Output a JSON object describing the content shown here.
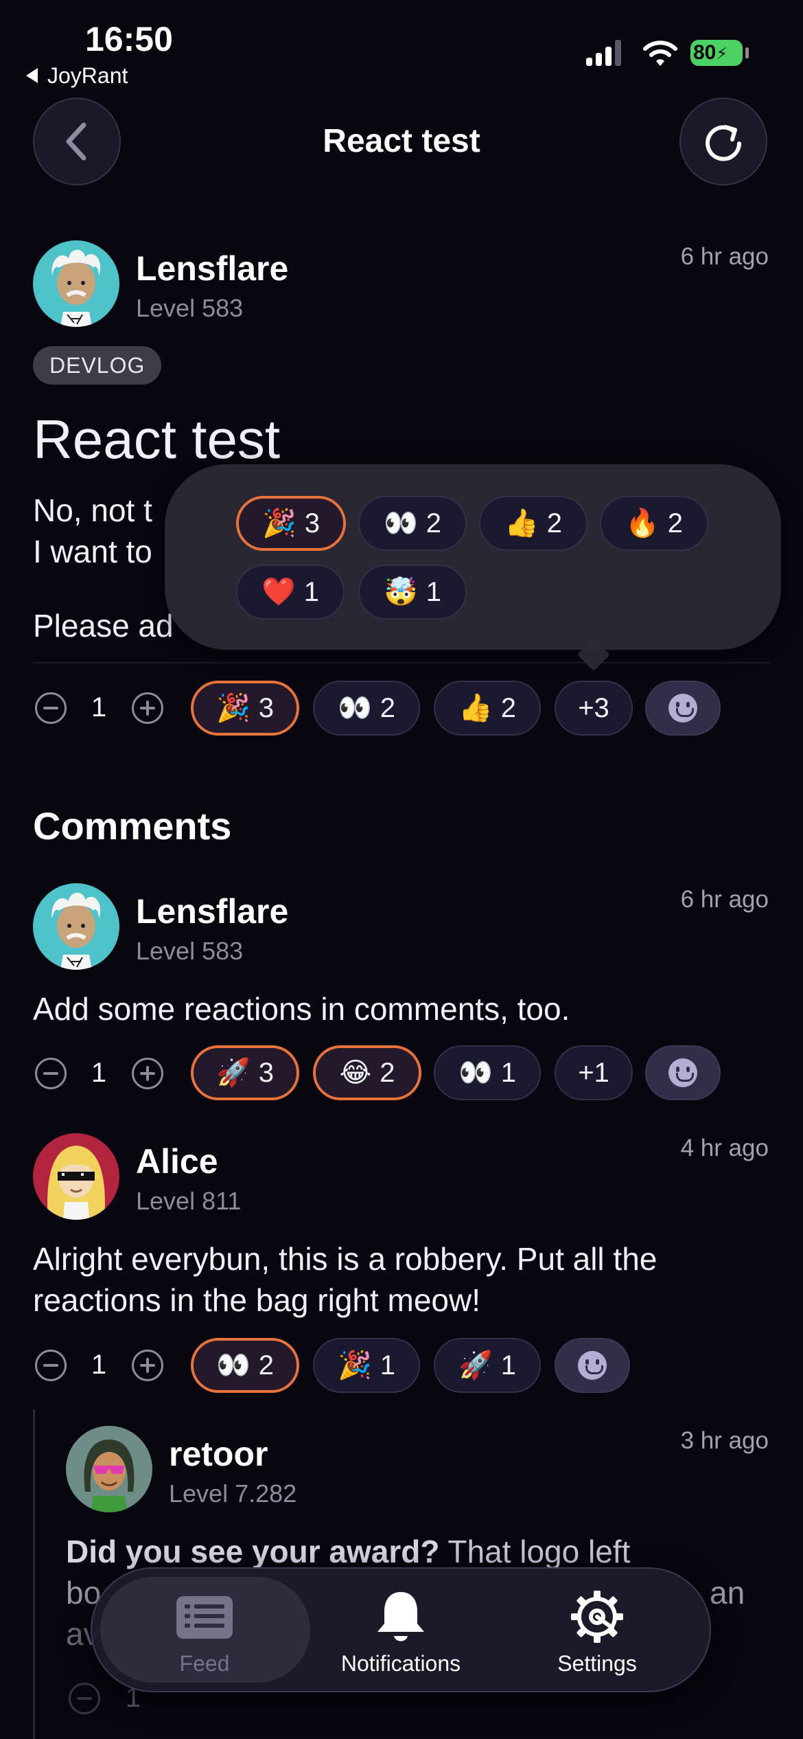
{
  "status_bar": {
    "time": "16:50",
    "back_app": "JoyRant",
    "battery": "80"
  },
  "header": {
    "title": "React test"
  },
  "post": {
    "author": "Lensflare",
    "level": "Level 583",
    "time": "6 hr ago",
    "tag": "DEVLOG",
    "title": "React test",
    "line1": "No, not t",
    "line2": "I want to",
    "line3": "Please ad",
    "score": "1",
    "reactions": [
      {
        "emoji": "🎉",
        "count": "3",
        "mine": true
      },
      {
        "emoji": "👀",
        "count": "2",
        "mine": false
      },
      {
        "emoji": "👍",
        "count": "2",
        "mine": false
      }
    ],
    "more": "+3"
  },
  "popover": {
    "reactions": [
      {
        "emoji": "🎉",
        "count": "3",
        "mine": true
      },
      {
        "emoji": "👀",
        "count": "2",
        "mine": false
      },
      {
        "emoji": "👍",
        "count": "2",
        "mine": false
      },
      {
        "emoji": "🔥",
        "count": "2",
        "mine": false
      },
      {
        "emoji": "❤️",
        "count": "1",
        "mine": false
      },
      {
        "emoji": "🤯",
        "count": "1",
        "mine": false
      }
    ]
  },
  "comments_title": "Comments",
  "comments": [
    {
      "author": "Lensflare",
      "level": "Level 583",
      "time": "6 hr ago",
      "text": "Add some reactions in comments, too.",
      "score": "1",
      "reactions": [
        {
          "emoji": "🚀",
          "count": "3"
        },
        {
          "emoji": "😂",
          "count": "2"
        },
        {
          "emoji": "👀",
          "count": "1"
        }
      ],
      "more": "+1"
    },
    {
      "author": "Alice",
      "level": "Level 811",
      "time": "4 hr ago",
      "line1": "Alright everybun, this is a robbery. Put all the",
      "line2": "reactions in the bag right meow!",
      "score": "1",
      "reactions": [
        {
          "emoji": "👀",
          "count": "2"
        },
        {
          "emoji": "🎉",
          "count": "1"
        },
        {
          "emoji": "🚀",
          "count": "1"
        }
      ]
    },
    {
      "author": "retoor",
      "level": "Level 7.282",
      "time": "3 hr ago",
      "bold": "Did you see your award?",
      "rest": " That logo left",
      "line2_start": "bo",
      "line2_end": "an",
      "line3_start": "av",
      "score": "1"
    }
  ],
  "tabs": {
    "feed": "Feed",
    "notifications": "Notifications",
    "settings": "Settings"
  },
  "colors": {
    "background": "#08060f",
    "accent_border": "#e8733a",
    "chip_bg": "#1b1930"
  }
}
